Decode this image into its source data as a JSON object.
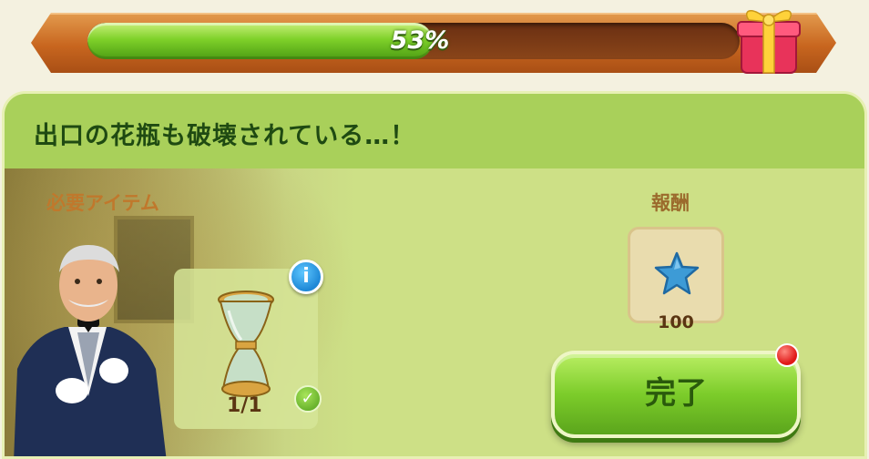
{
  "progress": {
    "fraction": 0.53,
    "label": "53%"
  },
  "quest": {
    "title": "出口の花瓶も破壊されている…！",
    "required_label": "必要アイテム",
    "item": {
      "icon": "vase-icon",
      "count": "1/1",
      "completed": true
    }
  },
  "reward": {
    "label": "報酬",
    "icon": "blue-star-icon",
    "amount": "100"
  },
  "actions": {
    "complete_label": "完了",
    "has_notification": true
  },
  "colors": {
    "panel": "#cde086",
    "header": "#a9d05a",
    "button": "#7ccc2a",
    "frame": "#c8661f"
  }
}
